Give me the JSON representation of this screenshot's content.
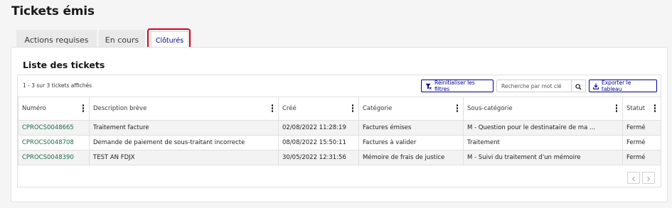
{
  "page": {
    "title": "Tickets émis"
  },
  "tabs": [
    {
      "label": "Actions requises"
    },
    {
      "label": "En cours"
    },
    {
      "label": "Clôturés",
      "active": true
    }
  ],
  "card": {
    "title": "Liste des tickets",
    "count_text": "1 - 3 sur 3 tickets affichés",
    "reset_filters_label": "Réinitialiser les filtres",
    "search": {
      "placeholder": "Recherche par mot clé",
      "value": ""
    },
    "export_label": "Exporter le tableau"
  },
  "table": {
    "columns": [
      "Numéro",
      "Description brève",
      "Créé",
      "Catégorie",
      "Sous-catégorie",
      "Statut"
    ],
    "rows": [
      {
        "numero": "CPROCS0048665",
        "description": "Traitement facture",
        "cree": "02/08/2022 11:28:19",
        "categorie": "Factures émises",
        "sous_categorie": "M - Question pour le destinataire de ma ...",
        "statut": "Fermé"
      },
      {
        "numero": "CPROCS0048708",
        "description": "Demande de paiement de sous-traitant incorrecte",
        "cree": "08/08/2022 15:50:11",
        "categorie": "Factures à valider",
        "sous_categorie": "Traitement",
        "statut": "Fermé"
      },
      {
        "numero": "CPROCS0048390",
        "description": "TEST AN FDJX",
        "cree": "30/05/2022 12:31:56",
        "categorie": "Mémoire de frais de justice",
        "sous_categorie": "M - Suivi du traitement d'un mémoire",
        "statut": "Fermé"
      }
    ]
  },
  "icons": {
    "filter": "filter-reset-icon",
    "search": "search-icon",
    "export": "download-icon",
    "prev": "chevron-left-icon",
    "next": "chevron-right-icon",
    "column_menu": "vertical-dots-icon"
  },
  "colors": {
    "accent": "#000091",
    "link": "#1d6b48",
    "focus": "#d9001b"
  }
}
